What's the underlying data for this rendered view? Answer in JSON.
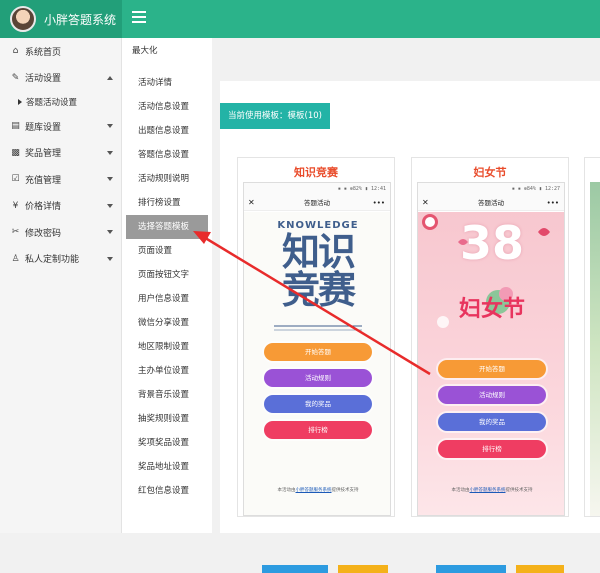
{
  "app": {
    "title": "小胖答题系统"
  },
  "sidebar": {
    "items": [
      {
        "icon": "home-icon",
        "glyph": "⌂",
        "label": "系统首页"
      },
      {
        "icon": "edit-icon",
        "glyph": "✎",
        "label": "活动设置",
        "arrow": "up"
      },
      {
        "sub": true,
        "label": "答题活动设置"
      },
      {
        "icon": "document-icon",
        "glyph": "▤",
        "label": "题库设置",
        "arrow": "down"
      },
      {
        "icon": "gift-icon",
        "glyph": "▩",
        "label": "奖品管理",
        "arrow": "down"
      },
      {
        "icon": "check-icon",
        "glyph": "☑",
        "label": "充值管理",
        "arrow": "down"
      },
      {
        "icon": "yen-icon",
        "glyph": "¥",
        "label": "价格详情",
        "arrow": "down"
      },
      {
        "icon": "wrench-icon",
        "glyph": "✂",
        "label": "修改密码",
        "arrow": "down"
      },
      {
        "icon": "user-icon",
        "glyph": "♙",
        "label": "私人定制功能",
        "arrow": "down"
      }
    ]
  },
  "subnav": {
    "title": "最大化",
    "items": [
      "活动详情",
      "活动信息设置",
      "出题信息设置",
      "答题信息设置",
      "活动规则说明",
      "排行榜设置",
      "选择答题模板",
      "页面设置",
      "页面按钮文字",
      "用户信息设置",
      "微信分享设置",
      "地区限制设置",
      "主办单位设置",
      "背景音乐设置",
      "抽奖规则设置",
      "奖项奖品设置",
      "奖品地址设置",
      "红包信息设置"
    ],
    "active_index": 6
  },
  "content": {
    "current_template_label": "当前使用模板：模板(10)"
  },
  "templates": [
    {
      "title": "知识竞赛",
      "status": "▪ ▪ ⊕82% ▮ 12:41",
      "nav_title": "答题活动",
      "close": "✕",
      "more": "•••",
      "headline_en": "KNOWLEDGE",
      "headline_cn_1": "知识",
      "headline_cn_2": "竞赛",
      "buttons": [
        "开始答题",
        "活动规则",
        "我的奖品",
        "排行榜"
      ],
      "footer_prefix": "本活动由",
      "footer_link": "小胖答题服务系统",
      "footer_suffix": "提供技术支持"
    },
    {
      "title": "妇女节",
      "status": "▪ ▪ ⊕84% ▮ 12:27",
      "nav_title": "答题活动",
      "close": "✕",
      "more": "•••",
      "headline_num": "38",
      "headline_cn": "妇女节",
      "buttons": [
        "开始答题",
        "活动规则",
        "我的奖品",
        "排行榜"
      ],
      "footer_prefix": "本活动由",
      "footer_link": "小胖答题服务系统",
      "footer_suffix": "提供技术支持"
    }
  ],
  "colors": {
    "header": "#2bb38a",
    "brand": "#229f79",
    "badge": "#23b3a6",
    "btn_orange": "#f79a36",
    "btn_purple": "#9a52d6",
    "btn_blue": "#5a6fd8",
    "btn_red": "#ef3d62",
    "arrow": "#e82b2b"
  }
}
